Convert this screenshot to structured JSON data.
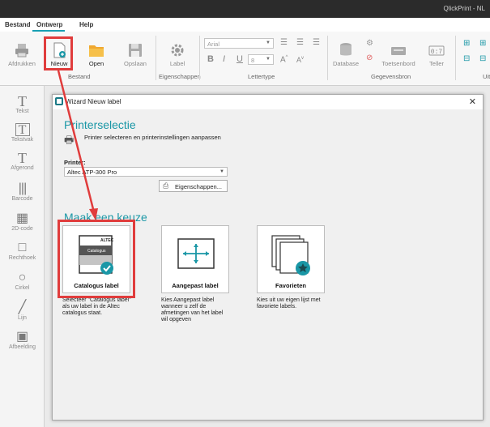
{
  "app": {
    "title": "QlickPrint - NL"
  },
  "menu": {
    "items": [
      "Bestand",
      "Ontwerp",
      "Help"
    ]
  },
  "ribbon": {
    "buttons": {
      "print": "Afdrukken",
      "new": "Nieuw",
      "open": "Open",
      "save": "Opslaan",
      "label": "Label",
      "database": "Database",
      "keyboard": "Toetsenbord",
      "counter": "Teller"
    },
    "groups": {
      "file": "Bestand",
      "properties": "Eigenschappen",
      "font": "Lettertype",
      "datasource": "Gegevensbron",
      "extra": "Uit"
    },
    "font_name_placeholder": "Arial",
    "font_size_placeholder": "8"
  },
  "tools": [
    "Tekst",
    "Tekstvak",
    "Afgerond",
    "Barcode",
    "2D-code",
    "Rechthoek",
    "Cirkel",
    "Lijn",
    "Afbeelding"
  ],
  "dialog": {
    "title": "Wizard Nieuw label",
    "printer_section": {
      "heading": "Printerselectie",
      "subtitle": "Printer selecteren en printerinstellingen aanpassen",
      "printer_label": "Printer:",
      "printer_value": "Altec ATP-300 Pro",
      "properties_button": "Eigenschappen..."
    },
    "choice_heading": "Maak een keuze",
    "cards": [
      {
        "label": "Catalogus label",
        "brand": "ALTEC",
        "inner": "Catalogus",
        "description": "Selecteer \"Catalogus label\" als uw label in de Altec catalogus staat."
      },
      {
        "label": "Aangepast label",
        "description": "Kies Aangepast label wanneer u zelf de afmetingen van het label wil opgeven"
      },
      {
        "label": "Favorieten",
        "description": "Kies uit uw eigen lijst met favoriete labels."
      }
    ]
  }
}
